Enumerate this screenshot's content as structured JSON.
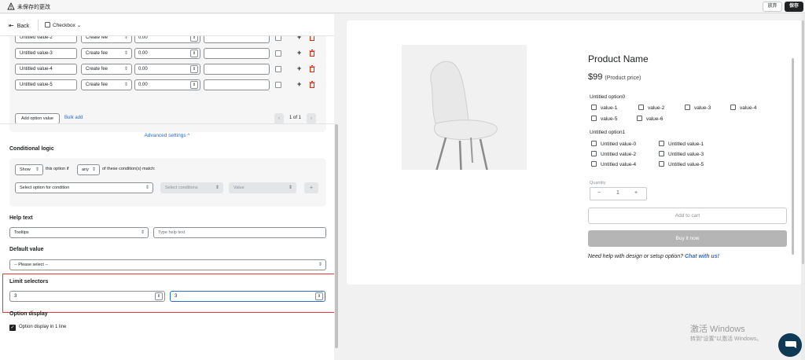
{
  "topbar": {
    "title": "未保存的更改",
    "discard": "放弃",
    "save": "保存"
  },
  "nav": {
    "back": "Back",
    "type": "Checkbox"
  },
  "values": [
    {
      "name": "Untitled value-2",
      "fee": "Create fee",
      "price": "0.00"
    },
    {
      "name": "Untitled value-3",
      "fee": "Create fee",
      "price": "0.00"
    },
    {
      "name": "Untitled value-4",
      "fee": "Create fee",
      "price": "0.00"
    },
    {
      "name": "Untitled value-5",
      "fee": "Create fee",
      "price": "0.00"
    }
  ],
  "option_actions": {
    "add": "Add option value",
    "bulk": "Bulk add",
    "page": "1 of 1"
  },
  "advanced": "Advanced settings ^",
  "conditional": {
    "title": "Conditional logic",
    "show": "Show",
    "text1": "this option if",
    "any": "any",
    "text2": "of these condition(s) match:",
    "select_option": "Select option for condition",
    "select_conditions": "Select conditions",
    "value": "Value",
    "plus": "+"
  },
  "help_text": {
    "title": "Help text",
    "type": "Tooltips",
    "placeholder": "Type help text"
  },
  "default_value": {
    "title": "Default value",
    "select": "-- Please select --"
  },
  "limit": {
    "title": "Limit selectors",
    "min": "3",
    "max": "3"
  },
  "display": {
    "title": "Option display",
    "checkbox": "Option display in 1 line"
  },
  "preview": {
    "product_name": "Product Name",
    "price": "$99",
    "price_sub": "(Product price)",
    "group0": "Untitled option0",
    "group0_values": [
      "value-1",
      "value-2",
      "value-3",
      "value-4",
      "value-5",
      "value-6"
    ],
    "group1": "Untitled option1",
    "group1_values": [
      "Untitled value-0",
      "Untitled value-1",
      "Untitled value-2",
      "Untitled value-3",
      "Untitled value-4",
      "Untitled value-5"
    ],
    "quantity_label": "Quantity",
    "quantity": "1",
    "minus": "−",
    "plus": "+",
    "add_to_cart": "Add to cart",
    "buy_now": "Buy it now",
    "help": "Need help with design or setup option?",
    "chat": "Chat with us!"
  },
  "watermark": {
    "line1": "激活 Windows",
    "line2": "转到\"设置\"以激活 Windows。"
  },
  "colors": {
    "accent": "#2c6ecb",
    "danger": "#e03e3e",
    "dark": "#202223"
  }
}
